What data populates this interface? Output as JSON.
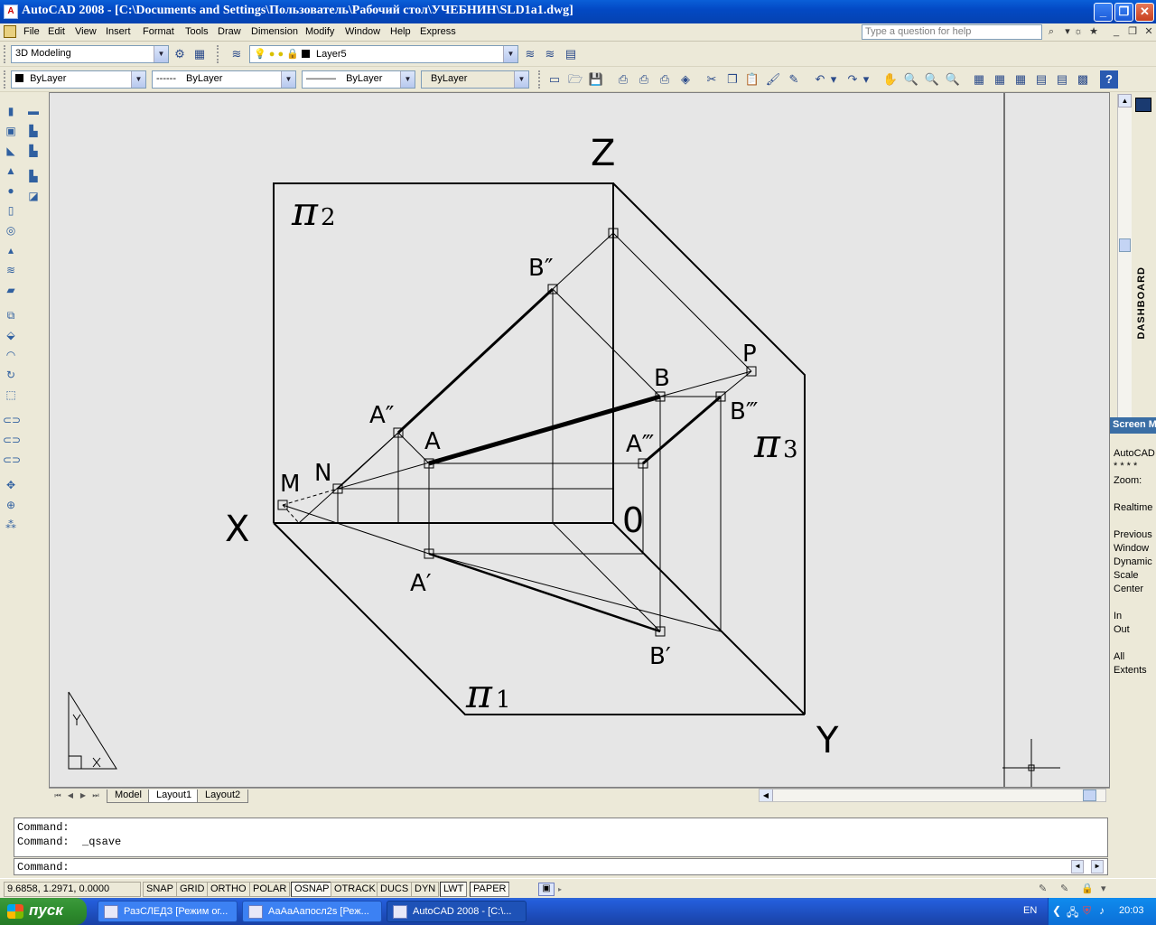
{
  "window": {
    "title": "AutoCAD 2008 - [C:\\Documents and Settings\\Пользователь\\Рабочий стол\\УЧЕБНИН\\SLD1a1.dwg]",
    "app_icon": "A"
  },
  "menu": {
    "items": [
      "File",
      "Edit",
      "View",
      "Insert",
      "Format",
      "Tools",
      "Draw",
      "Dimension",
      "Modify",
      "Window",
      "Help",
      "Express"
    ],
    "help_placeholder": "Type a question for help"
  },
  "toolbar1": {
    "workspace": "3D Modeling",
    "layer": "Layer5"
  },
  "toolbar2": {
    "color": "ByLayer",
    "linetype_preview": "------",
    "linetype": "ByLayer",
    "lineweight_preview": "———",
    "lineweight": "ByLayer",
    "plotstyle": "ByLayer"
  },
  "drawing": {
    "labels": {
      "Z": "Z",
      "X": "X",
      "Y": "Y",
      "O": "0",
      "pi2": "π",
      "pi2_sub": "2",
      "pi1": "π",
      "pi1_sub": "1",
      "pi3": "π",
      "pi3_sub": "3",
      "B2": "B″",
      "A2": "A″",
      "A": "A",
      "B": "B",
      "P": "P",
      "B3": "B‴",
      "A3": "A‴",
      "M": "M",
      "N": "N",
      "A1": "A′",
      "B1": "B′"
    }
  },
  "tabs": {
    "items": [
      "Model",
      "Layout1",
      "Layout2"
    ],
    "active": "Layout1"
  },
  "dashboard": {
    "label": "DASHBOARD"
  },
  "screen_menu": {
    "header": "Screen M",
    "items": [
      "AutoCAD",
      "* * * *",
      "Zoom:",
      "",
      "Realtime",
      "",
      "Previous",
      "Window",
      "Dynamic",
      "Scale",
      "Center",
      "",
      "In",
      "Out",
      "",
      "All",
      "Extents"
    ]
  },
  "command": {
    "history": [
      "Command:",
      "Command:  _qsave"
    ],
    "prompt": "Command:"
  },
  "status": {
    "coords": "9.6858, 1.2971, 0.0000",
    "buttons": [
      "SNAP",
      "GRID",
      "ORTHO",
      "POLAR",
      "OSNAP",
      "OTRACK",
      "DUCS",
      "DYN",
      "LWT",
      "PAPER"
    ],
    "on_buttons": [
      "OSNAP",
      "LWT",
      "PAPER"
    ]
  },
  "taskbar": {
    "start": "пуск",
    "items": [
      "РазСЛЕДЗ [Режим ог...",
      "АаАаАапосл2s [Реж...",
      "AutoCAD 2008 - [C:\\..."
    ],
    "active_item": 2,
    "lang": "EN",
    "clock": "20:03"
  }
}
